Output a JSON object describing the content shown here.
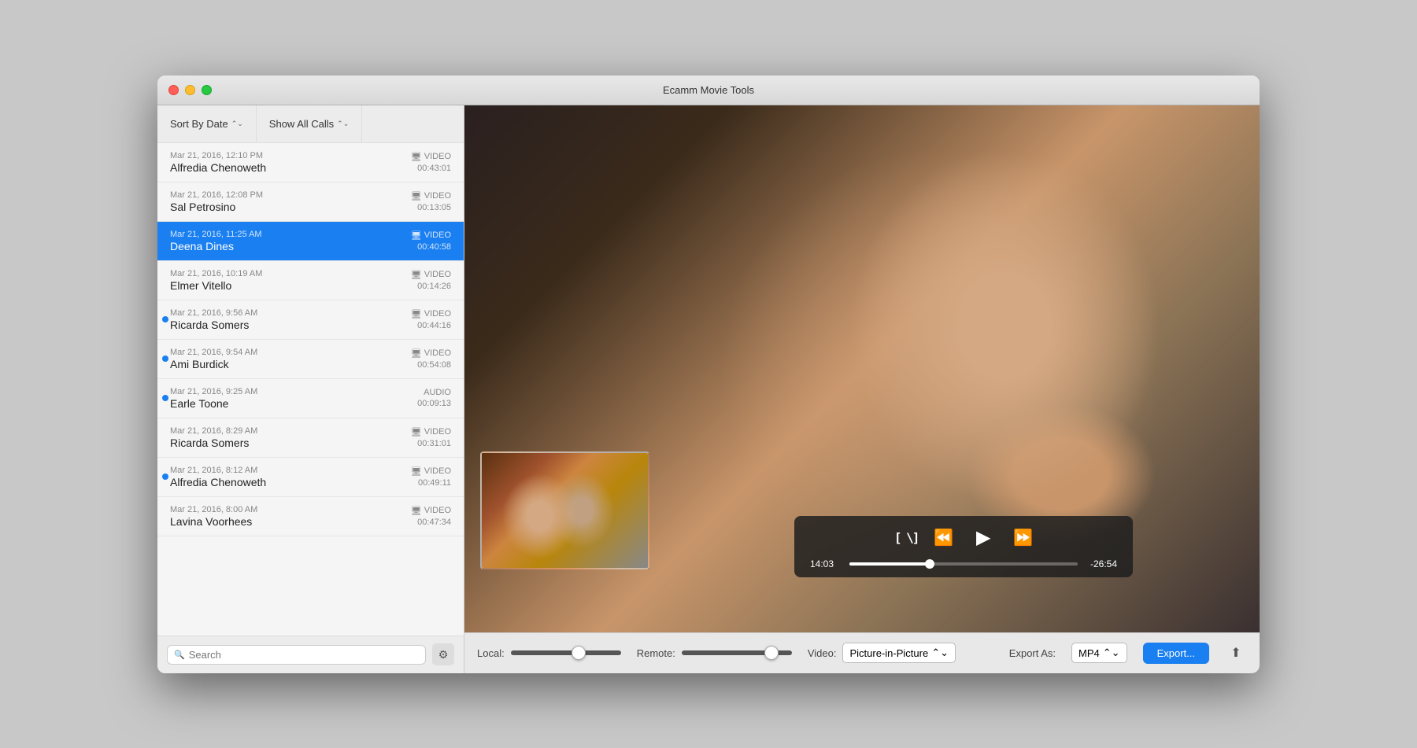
{
  "window": {
    "title": "Ecamm Movie Tools"
  },
  "sidebar": {
    "sort_btn": "Sort By Date",
    "show_btn": "Show All Calls",
    "search_placeholder": "Search"
  },
  "calls": [
    {
      "id": 1,
      "date": "Mar 21, 2016, 12:10 PM",
      "name": "Alfredia Chenoweth",
      "type": "VIDEO",
      "duration": "00:43:01",
      "unread": false,
      "selected": false
    },
    {
      "id": 2,
      "date": "Mar 21, 2016, 12:08 PM",
      "name": "Sal Petrosino",
      "type": "VIDEO",
      "duration": "00:13:05",
      "unread": false,
      "selected": false
    },
    {
      "id": 3,
      "date": "Mar 21, 2016, 11:25 AM",
      "name": "Deena Dines",
      "type": "VIDEO",
      "duration": "00:40:58",
      "unread": false,
      "selected": true
    },
    {
      "id": 4,
      "date": "Mar 21, 2016, 10:19 AM",
      "name": "Elmer Vitello",
      "type": "VIDEO",
      "duration": "00:14:26",
      "unread": false,
      "selected": false
    },
    {
      "id": 5,
      "date": "Mar 21, 2016, 9:56 AM",
      "name": "Ricarda Somers",
      "type": "VIDEO",
      "duration": "00:44:16",
      "unread": true,
      "selected": false
    },
    {
      "id": 6,
      "date": "Mar 21, 2016, 9:54 AM",
      "name": "Ami Burdick",
      "type": "VIDEO",
      "duration": "00:54:08",
      "unread": true,
      "selected": false
    },
    {
      "id": 7,
      "date": "Mar 21, 2016, 9:25 AM",
      "name": "Earle Toone",
      "type": "AUDIO",
      "duration": "00:09:13",
      "unread": true,
      "selected": false
    },
    {
      "id": 8,
      "date": "Mar 21, 2016, 8:29 AM",
      "name": "Ricarda Somers",
      "type": "VIDEO",
      "duration": "00:31:01",
      "unread": false,
      "selected": false
    },
    {
      "id": 9,
      "date": "Mar 21, 2016, 8:12 AM",
      "name": "Alfredia Chenoweth",
      "type": "VIDEO",
      "duration": "00:49:11",
      "unread": true,
      "selected": false
    },
    {
      "id": 10,
      "date": "Mar 21, 2016, 8:00 AM",
      "name": "Lavina Voorhees",
      "type": "VIDEO",
      "duration": "00:47:34",
      "unread": false,
      "selected": false
    }
  ],
  "player": {
    "current_time": "14:03",
    "remaining_time": "-26:54",
    "progress_percent": 35
  },
  "bottom_toolbar": {
    "local_label": "Local:",
    "remote_label": "Remote:",
    "video_label": "Video:",
    "video_option": "Picture-in-Picture",
    "export_label": "Export As:",
    "export_format": "MP4",
    "export_btn": "Export..."
  }
}
